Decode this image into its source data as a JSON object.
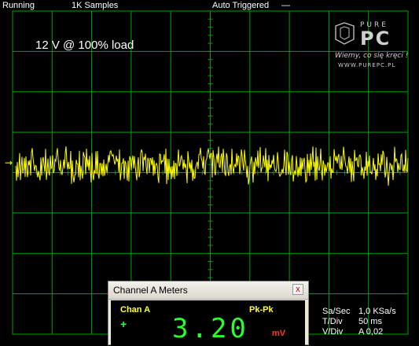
{
  "status_bar": {
    "run_state": "Running",
    "samples": "1K Samples",
    "trigger": "Auto Triggered",
    "dash": "—"
  },
  "caption": "12 V @ 100% load",
  "watermark": {
    "brand_top": "PURE",
    "brand_bottom": "PC",
    "slogan": "Wiemy, co się kręci !",
    "url": "WWW.PUREPC.PL"
  },
  "colors": {
    "grid": "#00a000",
    "trace": "#ffff00",
    "text": "#ffffff"
  },
  "chart_data": {
    "type": "line",
    "title": "",
    "xlabel": "",
    "ylabel": "",
    "time_per_div": "50 ms",
    "volts_per_div": "A 0,02",
    "divisions_x": 10,
    "divisions_y": 8,
    "trigger_marker": "→",
    "series": [
      {
        "name": "Channel A",
        "peak_to_peak": "3.20 mV",
        "description": "noise around 0 V"
      }
    ]
  },
  "settings": {
    "sa_sec_label": "Sa/Sec",
    "sa_sec_value": "1,0 KSa/s",
    "tdiv_label": "T/Div",
    "tdiv_value": "50 ms",
    "vdiv_label": "V/Div",
    "vdiv_value": "A 0,02"
  },
  "meters_window": {
    "title": "Channel A Meters",
    "close_glyph": "x",
    "channel_label": "Chan A",
    "measure_label": "Pk-Pk",
    "plus_glyph": "+",
    "value": "3.20",
    "unit": "mV"
  }
}
